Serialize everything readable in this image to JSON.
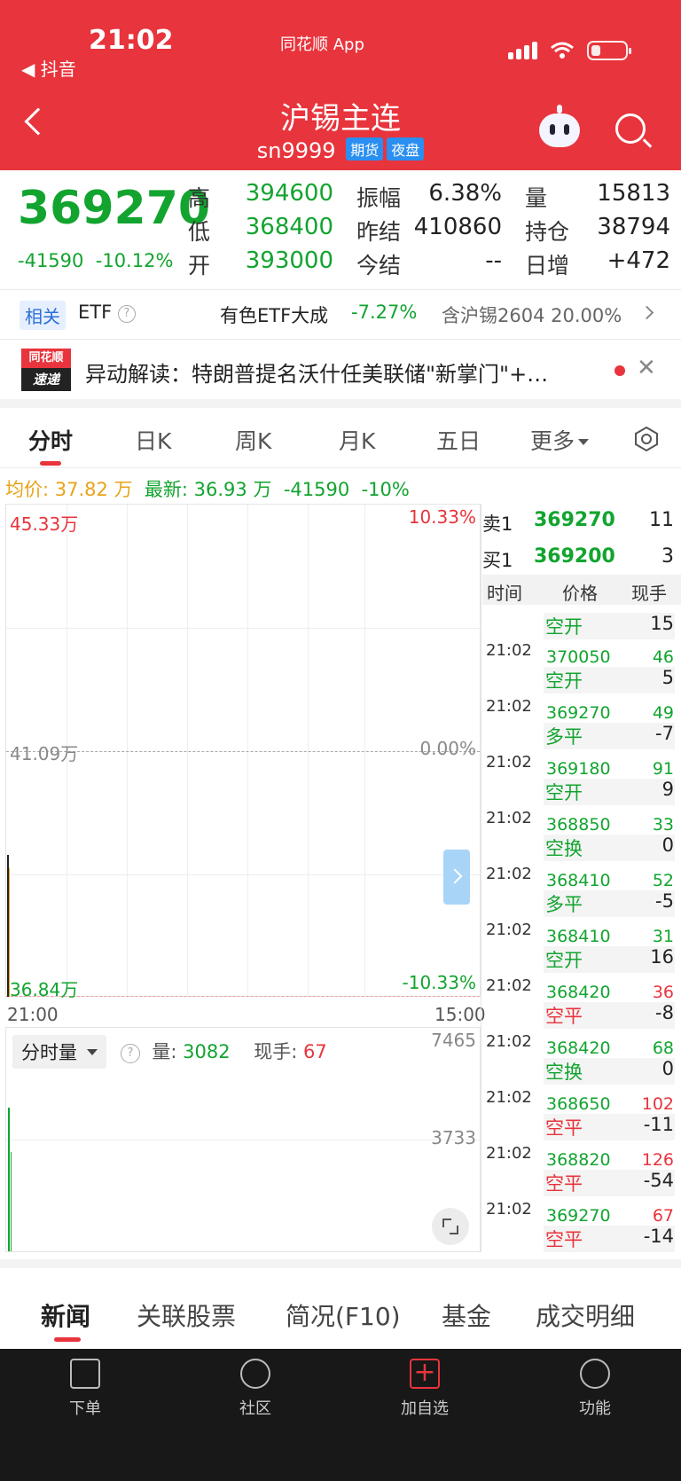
{
  "status": {
    "time": "21:02",
    "back_app": "◀ 抖音",
    "center_app": "同花顺 App"
  },
  "nav": {
    "title": "沪锡主连",
    "code": "sn9999",
    "tag1": "期货",
    "tag2": "夜盘"
  },
  "quote": {
    "price": "369270",
    "change": "-41590",
    "change_pct": "-10.12%",
    "rows": [
      {
        "l1": "高",
        "v1": "394600",
        "l2": "振幅",
        "v2": "6.38%",
        "l3": "量",
        "v3": "15813"
      },
      {
        "l1": "低",
        "v1": "368400",
        "l2": "昨结",
        "v2": "410860",
        "l3": "持仓",
        "v3": "38794"
      },
      {
        "l1": "开",
        "v1": "393000",
        "l2": "今结",
        "v2": "--",
        "l3": "日增",
        "v3": "+472"
      }
    ]
  },
  "etf": {
    "badge": "相关",
    "label": "ETF",
    "name": "有色ETF大成",
    "pct": "-7.27%",
    "holding": "含沪锡2604  20.00%"
  },
  "ticker": {
    "logo_top": "同花顺",
    "logo_bottom": "速递",
    "text": "异动解读：特朗普提名沃什任美联储\"新掌门\"+…"
  },
  "tabs": [
    "分时",
    "日K",
    "周K",
    "月K",
    "五日",
    "更多"
  ],
  "summary": {
    "avg_label": "均价: 37.82 万",
    "last_label": "最新: 36.93 万",
    "change": "-41590",
    "pct": "-10%"
  },
  "chart": {
    "top_price": "45.33万",
    "top_pct": "10.33%",
    "mid_price": "41.09万",
    "mid_pct": "0.00%",
    "bottom_price": "36.84万",
    "bottom_pct": "-10.33%",
    "time_start": "21:00",
    "time_end": "15:00"
  },
  "volume": {
    "selector": "分时量",
    "vol_label": "量:",
    "vol_value": "3082",
    "hand_label": "现手:",
    "hand_value": "67",
    "axis_top": "7465",
    "axis_mid": "3733"
  },
  "orderbook": {
    "sell_label": "卖1",
    "sell_price": "369270",
    "sell_qty": "11",
    "buy_label": "买1",
    "buy_price": "369200",
    "buy_qty": "3"
  },
  "trades_header": {
    "time": "时间",
    "price": "价格",
    "hand": "现手"
  },
  "trades_top_partial": {
    "type": "空开",
    "hand": "15"
  },
  "trades": [
    {
      "time": "21:02",
      "price": "370050",
      "qty": "46",
      "type": "空开",
      "hand": "5",
      "qcolor": "#12a42f",
      "tcolor": "#12a42f",
      "pcolor": "#12a42f"
    },
    {
      "time": "21:02",
      "price": "369270",
      "qty": "49",
      "type": "多平",
      "hand": "-7",
      "qcolor": "#12a42f",
      "tcolor": "#12a42f",
      "pcolor": "#12a42f"
    },
    {
      "time": "21:02",
      "price": "369180",
      "qty": "91",
      "type": "空开",
      "hand": "9",
      "qcolor": "#12a42f",
      "tcolor": "#12a42f",
      "pcolor": "#12a42f"
    },
    {
      "time": "21:02",
      "price": "368850",
      "qty": "33",
      "type": "空换",
      "hand": "0",
      "qcolor": "#12a42f",
      "tcolor": "#12a42f",
      "pcolor": "#12a42f"
    },
    {
      "time": "21:02",
      "price": "368410",
      "qty": "52",
      "type": "多平",
      "hand": "-5",
      "qcolor": "#12a42f",
      "tcolor": "#12a42f",
      "pcolor": "#12a42f"
    },
    {
      "time": "21:02",
      "price": "368410",
      "qty": "31",
      "type": "空开",
      "hand": "16",
      "qcolor": "#12a42f",
      "tcolor": "#12a42f",
      "pcolor": "#12a42f"
    },
    {
      "time": "21:02",
      "price": "368420",
      "qty": "36",
      "type": "空平",
      "hand": "-8",
      "qcolor": "#e8343c",
      "tcolor": "#e8343c",
      "pcolor": "#12a42f"
    },
    {
      "time": "21:02",
      "price": "368420",
      "qty": "68",
      "type": "空换",
      "hand": "0",
      "qcolor": "#12a42f",
      "tcolor": "#12a42f",
      "pcolor": "#12a42f"
    },
    {
      "time": "21:02",
      "price": "368650",
      "qty": "102",
      "type": "空平",
      "hand": "-11",
      "qcolor": "#e8343c",
      "tcolor": "#e8343c",
      "pcolor": "#12a42f"
    },
    {
      "time": "21:02",
      "price": "368820",
      "qty": "126",
      "type": "空平",
      "hand": "-54",
      "qcolor": "#e8343c",
      "tcolor": "#e8343c",
      "pcolor": "#12a42f"
    },
    {
      "time": "21:02",
      "price": "369270",
      "qty": "67",
      "type": "空平",
      "hand": "-14",
      "qcolor": "#e8343c",
      "tcolor": "#e8343c",
      "pcolor": "#12a42f"
    }
  ],
  "bottom_tabs": [
    "新闻",
    "关联股票",
    "简况(F10)",
    "基金",
    "成交明细"
  ],
  "bottom_bar": [
    {
      "label": "下单",
      "icon": "document-icon"
    },
    {
      "label": "社区",
      "icon": "star-badge-icon"
    },
    {
      "label": "加自选",
      "icon": "add-icon"
    },
    {
      "label": "功能",
      "icon": "menu-icon"
    }
  ],
  "colors": {
    "brand_red": "#e8343c",
    "down_green": "#12a42f",
    "avg_yellow": "#e8a317"
  }
}
